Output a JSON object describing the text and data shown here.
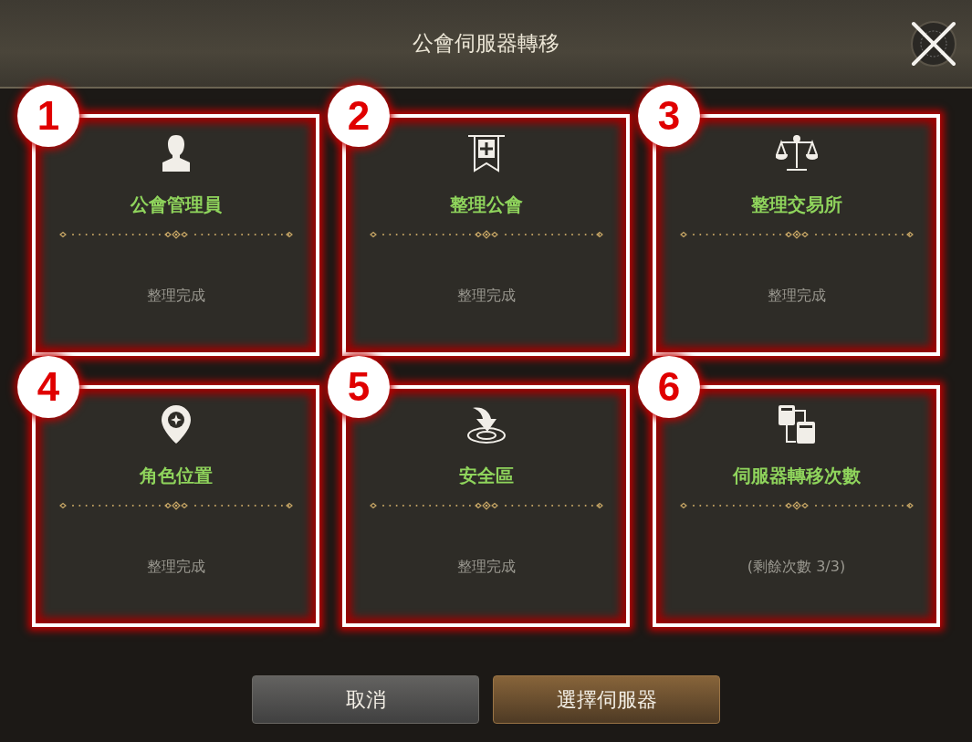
{
  "window": {
    "title": "公會伺服器轉移"
  },
  "cards": [
    {
      "number": "1",
      "kind": "person",
      "title": "公會管理員",
      "status": "整理完成"
    },
    {
      "number": "2",
      "kind": "banner",
      "title": "整理公會",
      "status": "整理完成"
    },
    {
      "number": "3",
      "kind": "scales",
      "title": "整理交易所",
      "status": "整理完成"
    },
    {
      "number": "4",
      "kind": "pin",
      "title": "角色位置",
      "status": "整理完成"
    },
    {
      "number": "5",
      "kind": "arrow",
      "title": "安全區",
      "status": "整理完成"
    },
    {
      "number": "6",
      "kind": "servers",
      "title": "伺服器轉移次數",
      "status": "(剩餘次數 3/3)"
    }
  ],
  "buttons": [
    {
      "label": "取消",
      "kind": "secondary"
    },
    {
      "label": "選擇伺服器",
      "kind": "primary"
    }
  ]
}
